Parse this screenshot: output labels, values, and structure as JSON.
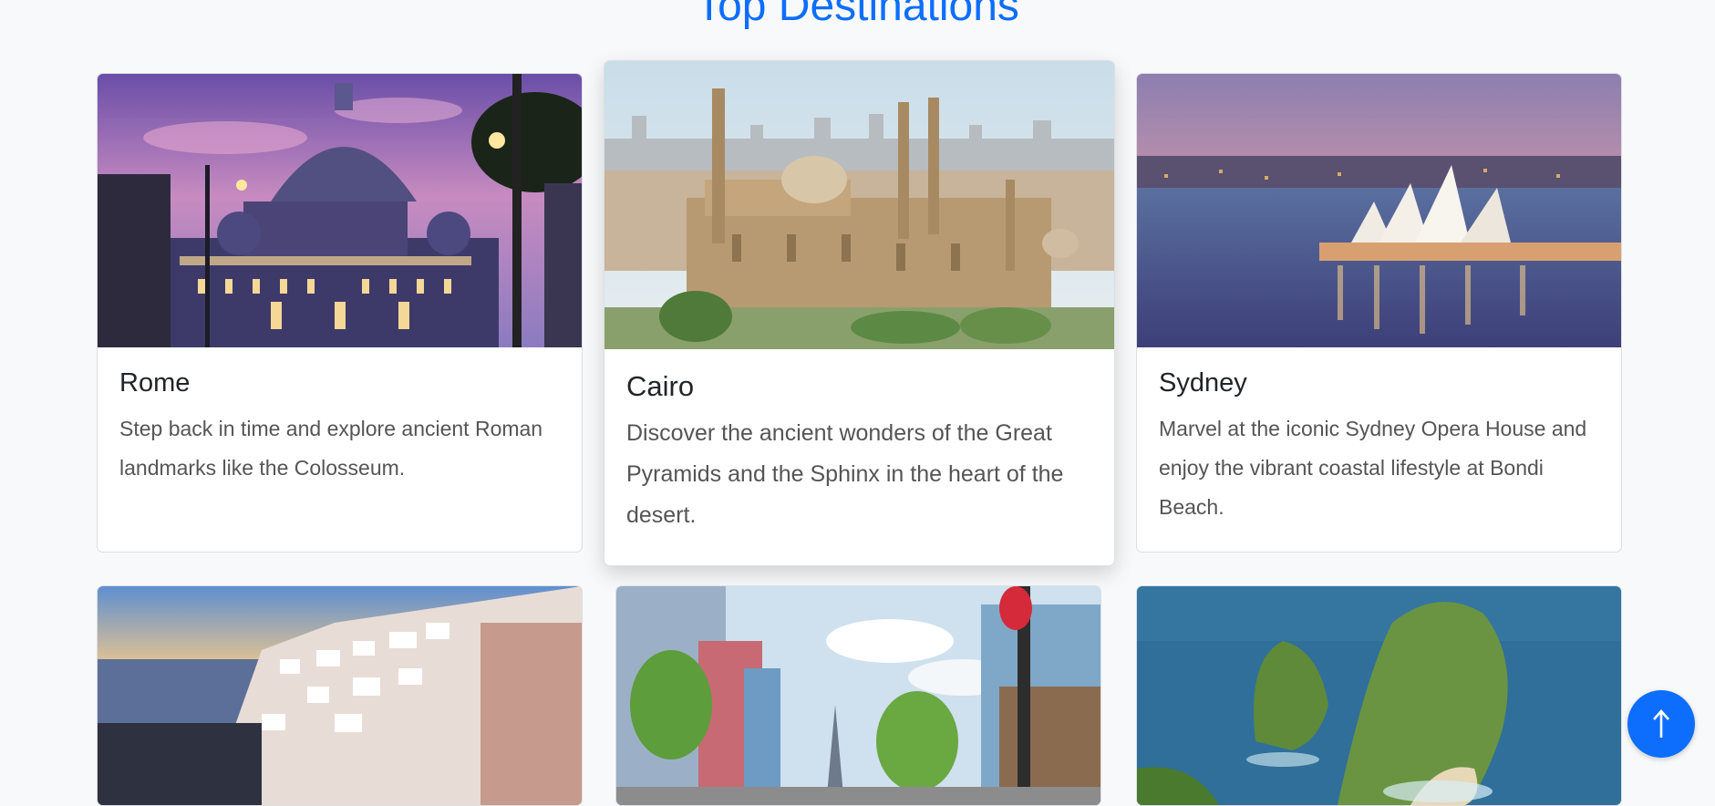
{
  "section": {
    "title": "Top Destinations"
  },
  "destinations": [
    {
      "name": "Rome",
      "description": "Step back in time and explore ancient Roman landmarks like the Colosseum."
    },
    {
      "name": "Cairo",
      "description": "Discover the ancient wonders of the Great Pyramids and the Sphinx in the heart of the desert."
    },
    {
      "name": "Sydney",
      "description": "Marvel at the iconic Sydney Opera House and enjoy the vibrant coastal lifestyle at Bondi Beach."
    },
    {
      "name": "",
      "description": ""
    },
    {
      "name": "",
      "description": ""
    },
    {
      "name": "",
      "description": ""
    }
  ],
  "scroll_top": {
    "icon": "arrow-up-icon"
  },
  "colors": {
    "accent": "#0d6efd",
    "background": "#f8f9fa"
  }
}
